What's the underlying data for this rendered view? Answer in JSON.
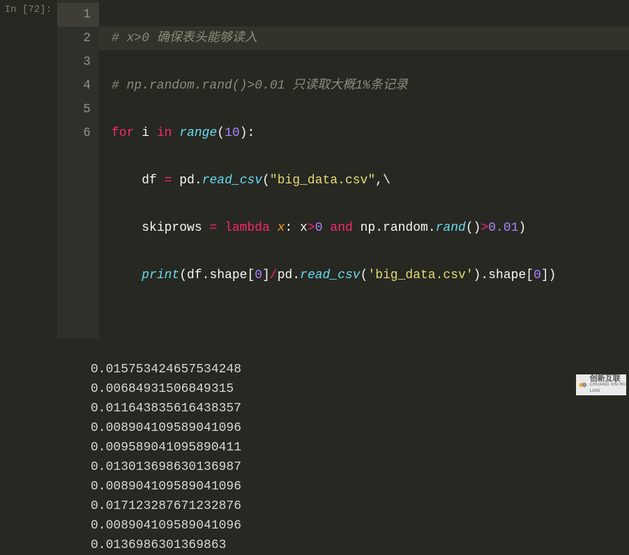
{
  "prompt": "In [72]:",
  "code": {
    "line1_comment": "# x>0 确保表头能够读入",
    "line2_comment": "# np.random.rand()>0.01 只读取大概1%条记录",
    "line3": {
      "kw_for": "for",
      "var_i": "i",
      "kw_in": "in",
      "fn_range": "range",
      "num_10": "10"
    },
    "line4": {
      "var_df": "df",
      "mod_pd": "pd",
      "fn_read_csv": "read_csv",
      "str_file": "\"big_data.csv\""
    },
    "line5": {
      "kw_skiprows": "skiprows",
      "kw_lambda": "lambda",
      "param_x": "x",
      "var_x": "x",
      "num_0": "0",
      "kw_and": "and",
      "mod_np": "np",
      "attr_random": "random",
      "fn_rand": "rand",
      "num_001": "0.01"
    },
    "line6": {
      "fn_print": "print",
      "var_df": "df",
      "attr_shape": "shape",
      "num_0": "0",
      "mod_pd": "pd",
      "fn_read_csv": "read_csv",
      "str_file": "'big_data.csv'"
    }
  },
  "line_numbers": [
    "1",
    "2",
    "3",
    "4",
    "5",
    "6"
  ],
  "output": [
    "0.015753424657534248",
    "0.00684931506849315",
    "0.011643835616438357",
    "0.008904109589041096",
    "0.009589041095890411",
    "0.013013698630136987",
    "0.008904109589041096",
    "0.017123287671232876",
    "0.008904109589041096",
    "0.0136986301369863"
  ],
  "logo": {
    "brand": "创新互联",
    "sub": "CHUANG XIN HU LIAN"
  }
}
